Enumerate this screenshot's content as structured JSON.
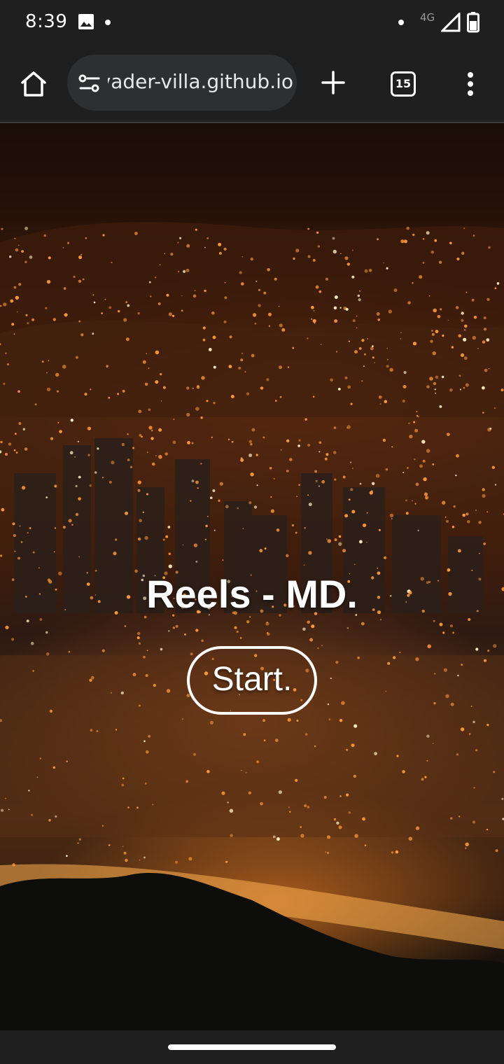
{
  "status_bar": {
    "time": "8:39",
    "network": "4G",
    "icons": [
      "gallery-icon",
      "notification-dot-icon",
      "signal-icon",
      "battery-icon"
    ]
  },
  "browser": {
    "url": "vader-villa.github.io",
    "url_visible": "ıder-villa.github.io",
    "tab_count": "15",
    "icons": [
      "home-icon",
      "site-settings-icon",
      "plus-icon",
      "tab-switcher-icon",
      "more-vert-icon"
    ]
  },
  "page": {
    "title": "Reels - MD.",
    "start_label": "Start."
  },
  "colors": {
    "chrome_bg": "#1f1f1f",
    "url_bar_bg": "#2e2f31",
    "text": "#ffffff",
    "city_light": "#ff8a2a"
  }
}
